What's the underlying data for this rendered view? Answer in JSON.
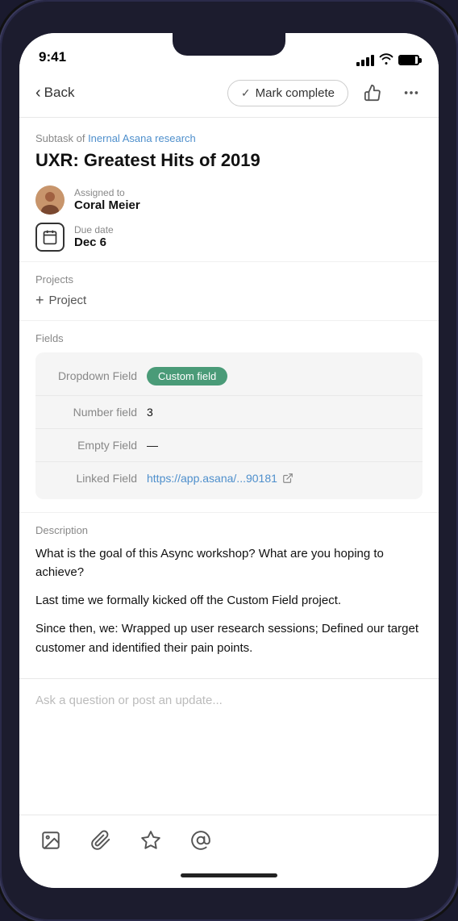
{
  "status_bar": {
    "time": "9:41"
  },
  "nav": {
    "back_label": "Back",
    "mark_complete_label": "Mark complete"
  },
  "task": {
    "subtask_prefix": "Subtask of",
    "subtask_link": "Inernal Asana research",
    "title": "UXR: Greatest Hits of 2019",
    "assigned_to_label": "Assigned to",
    "assignee": "Coral Meier",
    "due_date_label": "Due date",
    "due_date": "Dec 6"
  },
  "projects": {
    "label": "Projects",
    "add_label": "Project"
  },
  "fields": {
    "label": "Fields",
    "rows": [
      {
        "name": "Dropdown Field",
        "value": "Custom field",
        "type": "badge"
      },
      {
        "name": "Number field",
        "value": "3",
        "type": "text"
      },
      {
        "name": "Empty Field",
        "value": "—",
        "type": "text"
      },
      {
        "name": "Linked Field",
        "value": "https://app.asana/...90181",
        "type": "link"
      }
    ]
  },
  "description": {
    "label": "Description",
    "paragraphs": [
      "What is the goal of this Async workshop? What are you hoping to achieve?",
      "Last time we formally kicked off the Custom Field project.",
      "Since then, we: Wrapped up user research sessions; Defined our target customer and identified their pain points."
    ]
  },
  "comment": {
    "placeholder": "Ask a question or post an update..."
  },
  "toolbar": {
    "icons": [
      "photo-icon",
      "attachment-icon",
      "star-icon",
      "mention-icon"
    ]
  }
}
